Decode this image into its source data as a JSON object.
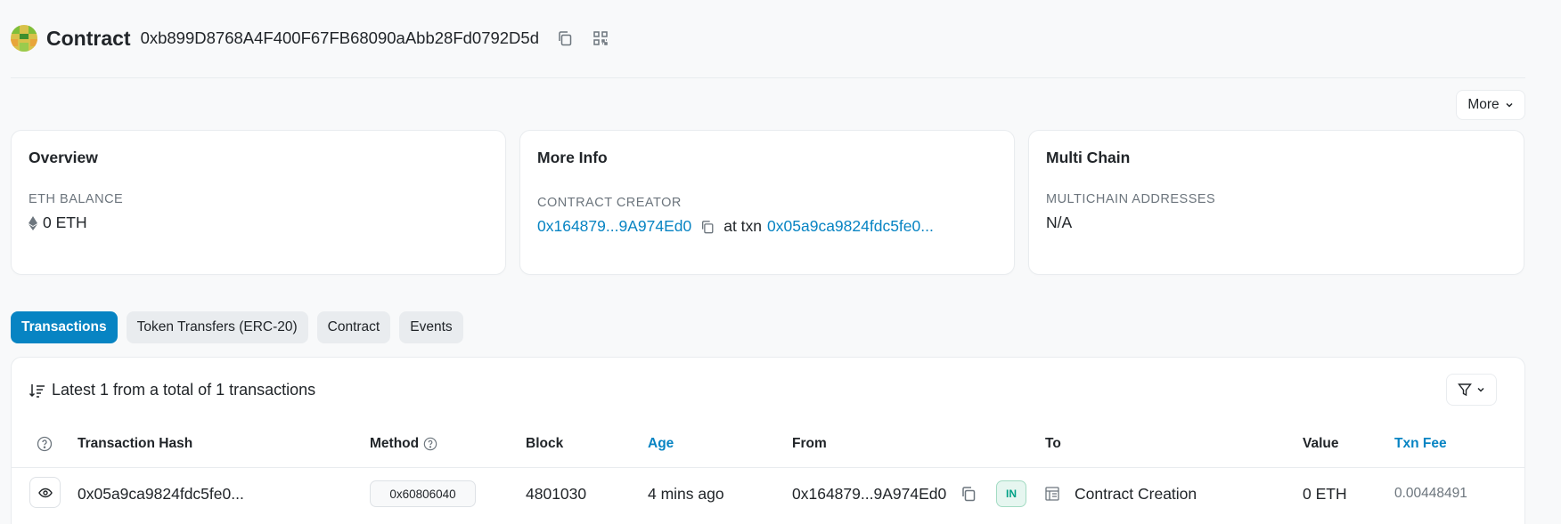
{
  "header": {
    "title": "Contract",
    "address": "0xb899D8768A4F400F67FB68090aAbb28Fd0792D5d",
    "copy_icon": "copy-icon",
    "qr_icon": "qr-code-icon"
  },
  "more_button": {
    "label": "More"
  },
  "overview": {
    "title": "Overview",
    "balance_label": "ETH BALANCE",
    "balance_value": "0 ETH"
  },
  "more_info": {
    "title": "More Info",
    "creator_label": "CONTRACT CREATOR",
    "creator_address": "0x164879...9A974Ed0",
    "at_txn_text": "at txn",
    "creation_txn": "0x05a9ca9824fdc5fe0..."
  },
  "multi_chain": {
    "title": "Multi Chain",
    "label": "MULTICHAIN ADDRESSES",
    "value": "N/A"
  },
  "tabs": [
    {
      "label": "Transactions",
      "active": true
    },
    {
      "label": "Token Transfers (ERC-20)",
      "active": false
    },
    {
      "label": "Contract",
      "active": false
    },
    {
      "label": "Events",
      "active": false
    }
  ],
  "transactions": {
    "summary": "Latest 1 from a total of 1 transactions",
    "columns": {
      "hash": "Transaction Hash",
      "method": "Method",
      "block": "Block",
      "age": "Age",
      "from": "From",
      "to": "To",
      "value": "Value",
      "fee": "Txn Fee"
    },
    "rows": [
      {
        "hash": "0x05a9ca9824fdc5fe0...",
        "method": "0x60806040",
        "block": "4801030",
        "age": "4 mins ago",
        "from": "0x164879...9A974Ed0",
        "direction": "IN",
        "to": "Contract Creation",
        "value": "0 ETH",
        "fee": "0.00448491"
      }
    ]
  },
  "colors": {
    "link": "#0784c3",
    "active_tab": "#0784c3",
    "in_badge": "#00a186"
  }
}
